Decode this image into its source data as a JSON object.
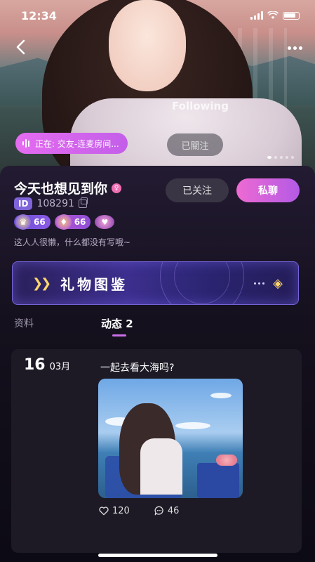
{
  "status_bar": {
    "time": "12:34"
  },
  "hero": {
    "following_ghost": "Following",
    "live_status": "正在: 交友-连麦房间...",
    "ghost_follow_label": "已關注",
    "carousel": {
      "count": 5,
      "active": 0
    }
  },
  "profile": {
    "name": "今天也想见到你",
    "id_label": "ID",
    "id_number": "108291",
    "followed_label": "已关注",
    "chat_label": "私聊",
    "badges": [
      {
        "icon": "crown-icon",
        "level": "66"
      },
      {
        "icon": "shield-icon",
        "level": "66"
      }
    ],
    "bio": "这人人很懒，什么都没有写哦~"
  },
  "gift_banner": {
    "title": "礼物图鉴"
  },
  "tabs": {
    "profile": "资料",
    "moments": "动态 2"
  },
  "post": {
    "day": "16",
    "month": "03月",
    "text": "一起去看大海吗?",
    "likes": "120",
    "comments": "46"
  },
  "colors": {
    "accent_pink": "#ee6ad2",
    "accent_purple": "#b35ae6",
    "id_badge": "#7f64d9",
    "card_bg": "#14101d"
  }
}
